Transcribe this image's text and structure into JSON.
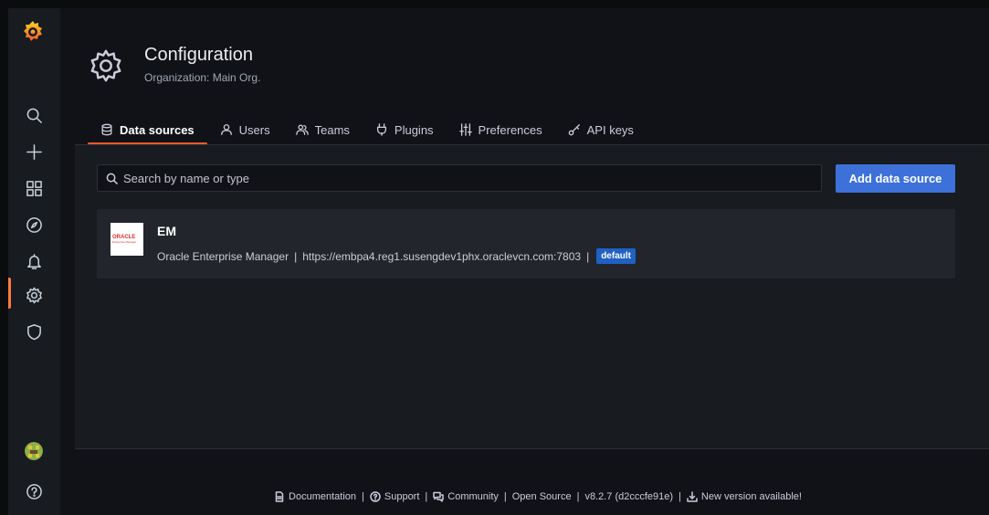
{
  "header": {
    "title": "Configuration",
    "subtitle": "Organization: Main Org."
  },
  "tabs": [
    {
      "label": "Data sources",
      "icon": "database-icon",
      "active": true
    },
    {
      "label": "Users",
      "icon": "user-icon"
    },
    {
      "label": "Teams",
      "icon": "users-icon"
    },
    {
      "label": "Plugins",
      "icon": "plug-icon"
    },
    {
      "label": "Preferences",
      "icon": "sliders-icon"
    },
    {
      "label": "API keys",
      "icon": "key-icon"
    }
  ],
  "search": {
    "placeholder": "Search by name or type"
  },
  "add_button": "Add data source",
  "datasource": {
    "logo_text": "ORACLE",
    "logo_subtext": "Enterprise Manager",
    "name": "EM",
    "type": "Oracle Enterprise Manager",
    "url": "https://embpa4.reg1.susengdev1phx.oraclevcn.com:7803",
    "badge": "default"
  },
  "sidebar": {
    "items": [
      "grafana-logo-icon",
      "search-icon",
      "plus-icon",
      "dashboards-icon",
      "explore-icon",
      "bell-icon",
      "gear-icon",
      "shield-icon",
      "avatar",
      "help-icon"
    ],
    "active": "gear-icon"
  },
  "footer": {
    "documentation": "Documentation",
    "support": "Support",
    "community": "Community",
    "open_source": "Open Source",
    "version": "v8.2.7 (d2cccfe91e)",
    "new_version": "New version available!"
  },
  "colors": {
    "accent": "#f05a28",
    "primary_button": "#3d71d9",
    "badge": "#1f60c4"
  }
}
